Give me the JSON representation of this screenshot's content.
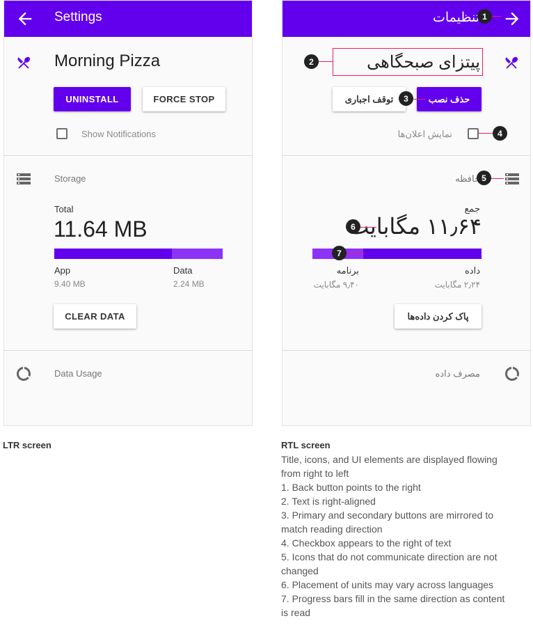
{
  "ltr": {
    "appbar": {
      "title": "Settings"
    },
    "app_name": "Morning Pizza",
    "buttons": {
      "uninstall": "UNINSTALL",
      "force_stop": "FORCE STOP"
    },
    "notifications_label": "Show Notifications",
    "storage": {
      "title": "Storage",
      "total_label": "Total",
      "total_value": "11.64 MB",
      "app_label": "App",
      "app_value": "9.40 MB",
      "data_label": "Data",
      "data_value": "2.24 MB",
      "app_fraction": 0.7,
      "clear_button": "CLEAR DATA"
    },
    "data_usage_label": "Data Usage"
  },
  "rtl": {
    "appbar": {
      "title": "تنظیمات"
    },
    "app_name": "پیتزای صبحگاهی",
    "buttons": {
      "uninstall": "حذف نصب",
      "force_stop": "توقف اجباری"
    },
    "notifications_label": "نمایش اعلان‌ها",
    "storage": {
      "title": "حافظه",
      "total_label": "جمع",
      "total_value": "۱۱٫۶۴ مگابایت",
      "app_label": "برنامه",
      "app_value": "۹٫۴۰ مگابایت",
      "data_label": "داده",
      "data_value": "۲٫۲۴ مگابایت",
      "app_fraction": 0.7,
      "clear_button": "پاک کردن داده‌ها"
    },
    "data_usage_label": "مصرف داده"
  },
  "callouts": [
    "1",
    "2",
    "3",
    "4",
    "5",
    "6",
    "7"
  ],
  "captions": {
    "ltr_heading": "LTR screen",
    "rtl_heading": "RTL screen",
    "rtl_lines": [
      "Title, icons, and UI elements are displayed flowing",
      "from right to left",
      "1. Back button points to the right",
      "2. Text is right-aligned",
      "3. Primary and secondary buttons are mirrored to",
      "match reading direction",
      "4. Checkbox appears to the right of text",
      "5. Icons that do not communicate direction are not",
      "changed",
      "6. Placement of units may vary across languages",
      "7. Progress bars fill in the same direction as content",
      "is read"
    ]
  },
  "colors": {
    "primary": "#6200ee",
    "progress_track": "#8c33f8",
    "callout": "#222222",
    "callout_line": "#e91e63"
  },
  "icons": [
    "arrow-back-icon",
    "arrow-forward-icon",
    "restaurant-icon",
    "storage-icon",
    "data-usage-icon",
    "checkbox-icon"
  ]
}
